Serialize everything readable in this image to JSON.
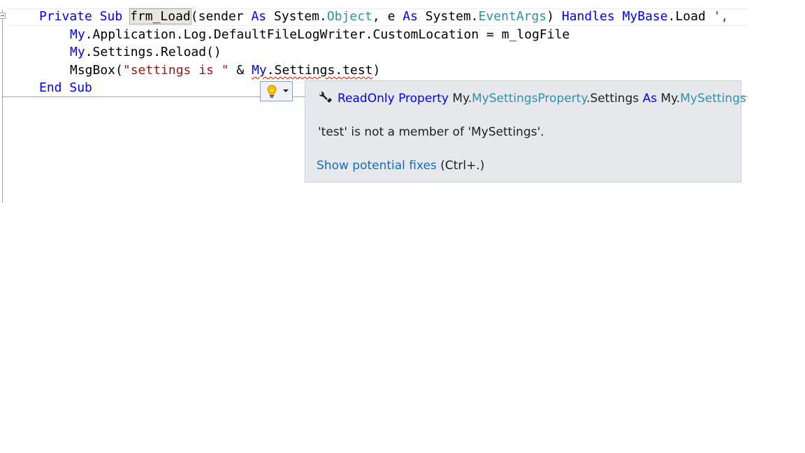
{
  "code": {
    "line1": {
      "private_kw": "Private",
      "sub_kw": "Sub",
      "method_name": "frm_Load",
      "paren_sender": "(sender ",
      "as_kw_1": "As",
      "system_1": " System.",
      "object_type": "Object",
      "comma_e": ", e ",
      "as_kw_2": "As",
      "system_2": " System.",
      "eventargs_type": "EventArgs",
      "close_paren": ") ",
      "handles_kw": "Handles",
      "mybase_kw": "MyBase",
      "load_text": ".Load ",
      "comment_text": "',"
    },
    "line2": {
      "my_kw": "My",
      "rest": ".Application.Log.DefaultFileLogWriter.CustomLocation = m_logFile"
    },
    "line3": {
      "my_kw": "My",
      "rest": ".Settings.Reload()"
    },
    "line4": {
      "msgbox": "MsgBox(",
      "string_literal": "\"settings is \"",
      "amp": " & ",
      "my_kw": "My",
      "member_access": ".Settings.test",
      "close": ")"
    },
    "line5": {
      "end_kw": "End",
      "sub_kw": "Sub"
    }
  },
  "quickinfo": {
    "signature": {
      "readonly_kw": "ReadOnly",
      "property_kw": "Property",
      "my_prefix": "My.",
      "mysettingsproperty_type": "MySettingsProperty",
      "settings_member": ".Settings",
      "as_kw": "As",
      "my_prefix_2": "My.",
      "mysettings_type": "MySettings"
    },
    "message": "'test' is not a member of 'MySettings'.",
    "fix_link": "Show potential fixes",
    "fix_shortcut": "(Ctrl+.)"
  },
  "colors": {
    "keyword": "#0000ff",
    "type": "#2b91af",
    "string": "#a31515",
    "comment": "#008000",
    "error_squiggle": "#e51400",
    "link": "#0e70c0",
    "tooltip_bg": "#e7e8ec"
  },
  "icons": {
    "lightbulb": "lightbulb-icon",
    "dropdown": "chevron-down-icon",
    "property": "wrench-icon",
    "collapse": "collapse-minus-icon"
  }
}
